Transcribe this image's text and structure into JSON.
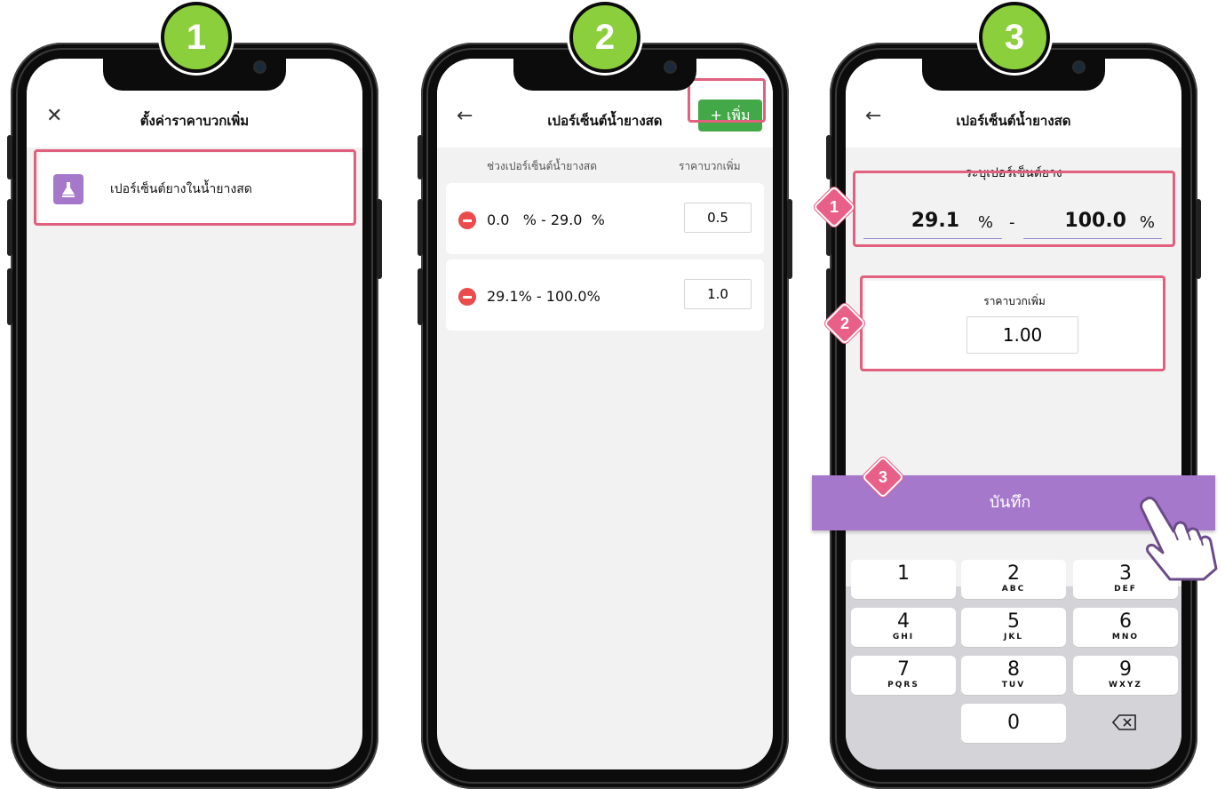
{
  "steps": [
    "1",
    "2",
    "3"
  ],
  "phone1": {
    "title": "ตั้งค่าราคาบวกเพิ่ม",
    "item_label": "เปอร์เซ็นต์ยางในน้ำยางสด"
  },
  "phone2": {
    "title": "เปอร์เซ็นต์น้ำยางสด",
    "add_button": "+ เพิ่ม",
    "col_range": "ช่วงเปอร์เซ็นต์น้ำยางสด",
    "col_price": "ราคาบวกเพิ่ม",
    "rows": [
      {
        "range": "0.0   % - 29.0  %",
        "value": "0.5"
      },
      {
        "range": "29.1% - 100.0%",
        "value": "1.0"
      }
    ]
  },
  "phone3": {
    "title": "เปอร์เซ็นต์น้ำยางสด",
    "range_label": "ระบุเปอร์เซ็นต์ยาง",
    "from_value": "29.1",
    "to_value": "100.0",
    "percent": "%",
    "dash": "-",
    "price_label": "ราคาบวกเพิ่ม",
    "price_value": "1.00",
    "save_button": "บันทึก",
    "markers": [
      "1",
      "2",
      "3"
    ],
    "keypad": [
      {
        "d": "1",
        "l": ""
      },
      {
        "d": "2",
        "l": "ABC"
      },
      {
        "d": "3",
        "l": "DEF"
      },
      {
        "d": "4",
        "l": "GHI"
      },
      {
        "d": "5",
        "l": "JKL"
      },
      {
        "d": "6",
        "l": "MNO"
      },
      {
        "d": "7",
        "l": "PQRS"
      },
      {
        "d": "8",
        "l": "TUV"
      },
      {
        "d": "9",
        "l": "WXYZ"
      },
      {
        "d": "0",
        "l": ""
      }
    ]
  },
  "colors": {
    "accent_green": "#43a847",
    "purple": "#a678cc",
    "highlight_pink": "#e0607e",
    "step_green": "#8ccf3c",
    "minus_red": "#ec4b4b"
  },
  "icons": {
    "close": "close-icon",
    "back": "arrow-left-icon",
    "item": "latex-flask-icon",
    "remove": "minus-circle-icon",
    "backspace": "backspace-icon",
    "pointer": "hand-pointer-icon"
  }
}
